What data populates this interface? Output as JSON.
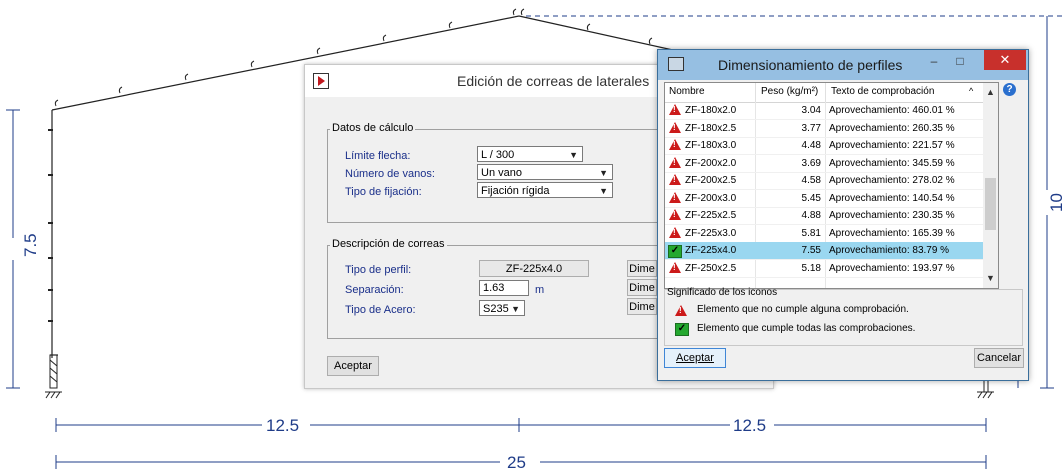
{
  "drawing": {
    "dimensions": {
      "left_height": "7.5",
      "right_height": "10",
      "bay_left": "12.5",
      "bay_right": "12.5",
      "total_span": "25"
    }
  },
  "edit_dialog": {
    "title": "Edición de correas de laterales",
    "calc_group": {
      "legend": "Datos de cálculo",
      "limit_label": "Límite flecha:",
      "limit_value": "L / 300",
      "spans_label": "Número de vanos:",
      "spans_value": "Un vano",
      "fix_label": "Tipo de fijación:",
      "fix_value": "Fijación rígida"
    },
    "desc_group": {
      "legend": "Descripción de correas",
      "profile_type_label": "Tipo de perfil:",
      "profile_type_value": "ZF-225x4.0",
      "separation_label": "Separación:",
      "separation_value": "1.63",
      "separation_unit": "m",
      "steel_label": "Tipo de Acero:",
      "steel_value": "S235",
      "dim_button": "Dime"
    },
    "accept": "Aceptar"
  },
  "profile_dialog": {
    "title": "Dimensionamiento de perfiles",
    "minimize": "–",
    "maximize": "□",
    "close": "✕",
    "help": "?",
    "columns": [
      "Nombre",
      "Peso (kg/m²)",
      "Texto de comprobación"
    ],
    "rows": [
      {
        "name": "ZF-180x2.0",
        "weight": "3.04",
        "text": "Aprovechamiento: 460.01 %",
        "status": "warn"
      },
      {
        "name": "ZF-180x2.5",
        "weight": "3.77",
        "text": "Aprovechamiento: 260.35 %",
        "status": "warn"
      },
      {
        "name": "ZF-180x3.0",
        "weight": "4.48",
        "text": "Aprovechamiento: 221.57 %",
        "status": "warn"
      },
      {
        "name": "ZF-200x2.0",
        "weight": "3.69",
        "text": "Aprovechamiento: 345.59 %",
        "status": "warn"
      },
      {
        "name": "ZF-200x2.5",
        "weight": "4.58",
        "text": "Aprovechamiento: 278.02 %",
        "status": "warn"
      },
      {
        "name": "ZF-200x3.0",
        "weight": "5.45",
        "text": "Aprovechamiento: 140.54 %",
        "status": "warn"
      },
      {
        "name": "ZF-225x2.5",
        "weight": "4.88",
        "text": "Aprovechamiento: 230.35 %",
        "status": "warn"
      },
      {
        "name": "ZF-225x3.0",
        "weight": "5.81",
        "text": "Aprovechamiento: 165.39 %",
        "status": "warn"
      },
      {
        "name": "ZF-225x4.0",
        "weight": "7.55",
        "text": "Aprovechamiento: 83.79 %",
        "status": "ok"
      },
      {
        "name": "ZF-250x2.5",
        "weight": "5.18",
        "text": "Aprovechamiento: 193.97 %",
        "status": "warn"
      }
    ],
    "legend": {
      "title": "Significado de los iconos",
      "warn_text": "Elemento que no cumple alguna comprobación.",
      "ok_text": "Elemento que cumple todas las comprobaciones."
    },
    "accept": "Aceptar",
    "cancel": "Cancelar"
  }
}
